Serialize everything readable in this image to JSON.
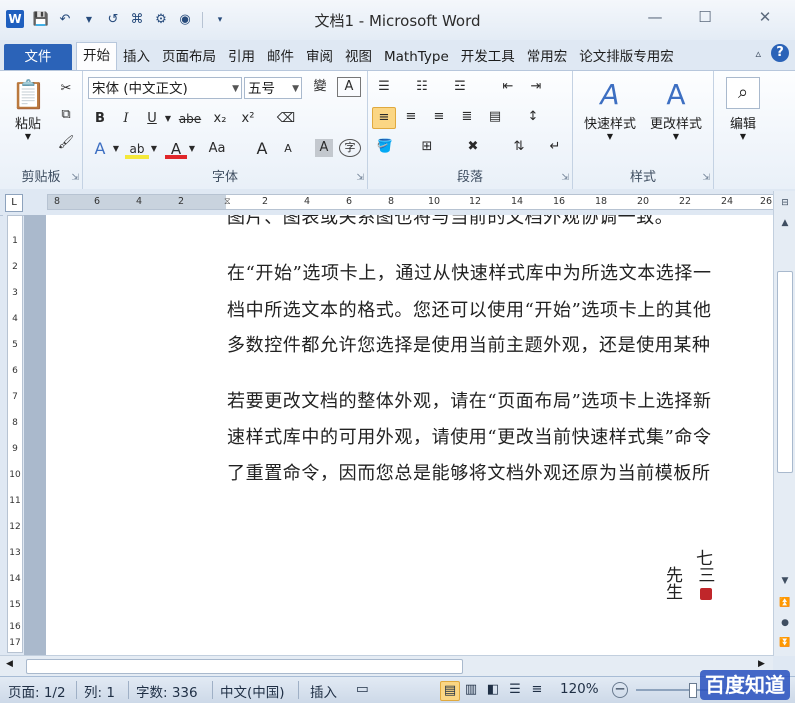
{
  "window": {
    "title": "文档1 - Microsoft Word",
    "logo_letter": "W",
    "controls": [
      "—",
      "☐",
      "✕"
    ]
  },
  "qat": {
    "save_icon": "💾",
    "undo_icon": "↶",
    "redo_icon": "↺",
    "extra1_icon": "⌘",
    "extra2_icon": "⚙",
    "extra3_icon": "◉"
  },
  "tabs": [
    {
      "label": "文件"
    },
    {
      "label": "开始"
    },
    {
      "label": "插入"
    },
    {
      "label": "页面布局"
    },
    {
      "label": "引用"
    },
    {
      "label": "邮件"
    },
    {
      "label": "审阅"
    },
    {
      "label": "视图"
    },
    {
      "label": "MathType"
    },
    {
      "label": "开发工具"
    },
    {
      "label": "常用宏"
    },
    {
      "label": "论文排版专用宏"
    }
  ],
  "ribbon": {
    "clipboard": {
      "paste_label": "粘贴",
      "group_label": "剪贴板"
    },
    "font": {
      "font_name": "宋体 (中文正文)",
      "font_size": "五号",
      "bold": "B",
      "italic": "I",
      "underline": "U",
      "strike": "abe",
      "subscript": "x₂",
      "superscript": "x²",
      "grow": "A",
      "shrink": "A",
      "case": "Aa",
      "group_label": "字体"
    },
    "paragraph": {
      "group_label": "段落"
    },
    "styles": {
      "quick_styles": "快速样式",
      "change_styles": "更改样式",
      "group_label": "样式"
    },
    "editing": {
      "label": "编辑"
    }
  },
  "ruler": {
    "h_ticks": [
      "8",
      "6",
      "4",
      "2",
      "",
      "2",
      "4",
      "6",
      "8",
      "10",
      "12",
      "14",
      "16",
      "18",
      "20",
      "22",
      "24",
      "26"
    ],
    "v_ticks": [
      "1",
      "2",
      "3",
      "4",
      "5",
      "6",
      "7",
      "8",
      "9",
      "10",
      "11",
      "12",
      "13",
      "14",
      "15",
      "16",
      "17"
    ]
  },
  "document": {
    "lines": [
      "图片、图表或关系图也将与当前的文档外观协调一致。",
      "在“开始”选项卡上，通过从快速样式库中为所选文本选择一",
      "档中所选文本的格式。您还可以使用“开始”选项卡上的其他",
      "多数控件都允许您选择是使用当前主题外观，还是使用某种",
      "若要更改文档的整体外观，请在“页面布局”选项卡上选择新",
      "速样式库中的可用外观，请使用“更改当前快速样式集”命令",
      "了重置命令，因而您总是能够将文档外观还原为当前模板所"
    ],
    "seal_chars": [
      "七",
      "三",
      "先",
      "生"
    ]
  },
  "status": {
    "page": "页面: 1/2",
    "column": "列: 1",
    "word_count": "字数: 336",
    "language": "中文(中国)",
    "insert_mode": "插入",
    "zoom": "120%",
    "zoom_out": "−",
    "zoom_in": "+"
  },
  "watermark": "百度知道",
  "colors": {
    "accent": "#2b63b8",
    "ribbon_bg": "#e9f0f8",
    "highlight": "#fbd684"
  }
}
